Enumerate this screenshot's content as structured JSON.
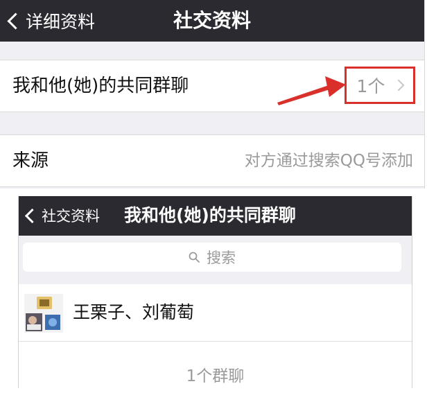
{
  "top_screen": {
    "back_label": "详细资料",
    "title": "社交资料",
    "common_groups": {
      "label": "我和他(她)的共同群聊",
      "value": "1个"
    },
    "source": {
      "label": "来源",
      "value": "对方通过搜索QQ号添加"
    },
    "highlight_color": "#d9302c"
  },
  "bottom_screen": {
    "back_label": "社交资料",
    "title": "我和他(她)的共同群聊",
    "search": {
      "placeholder": "搜索"
    },
    "groups": [
      {
        "name": "王栗子、刘葡萄",
        "avatar": "group-avatar-icon"
      }
    ],
    "footer": "1个群聊"
  },
  "colors": {
    "navbar": "#2a2a30",
    "background": "#efeff4",
    "secondary_text": "#9a9a9a"
  }
}
